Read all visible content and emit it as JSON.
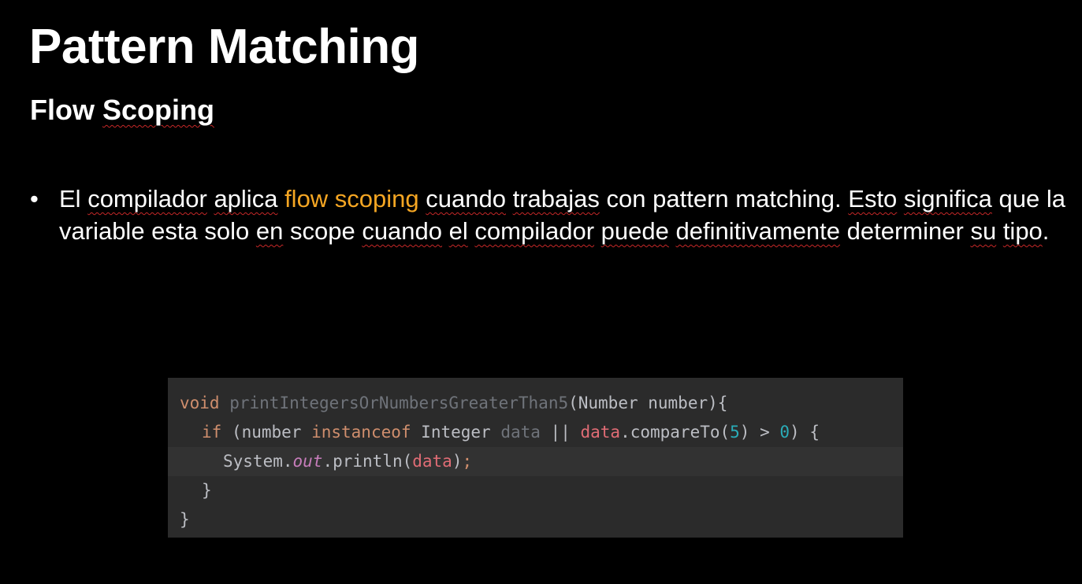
{
  "slide": {
    "title": "Pattern Matching",
    "subtitle": "Flow Scoping",
    "bullet": {
      "symbol": "•",
      "segments": [
        {
          "text": "El ",
          "style": "plain"
        },
        {
          "text": "compilador",
          "style": "squiggle"
        },
        {
          "text": " ",
          "style": "plain"
        },
        {
          "text": "aplica",
          "style": "squiggle"
        },
        {
          "text": " ",
          "style": "plain"
        },
        {
          "text": "flow scoping",
          "style": "highlight"
        },
        {
          "text": " ",
          "style": "plain"
        },
        {
          "text": "cuando",
          "style": "squiggle"
        },
        {
          "text": " ",
          "style": "plain"
        },
        {
          "text": "trabajas",
          "style": "squiggle"
        },
        {
          "text": " con pattern matching. ",
          "style": "plain"
        },
        {
          "text": "Esto",
          "style": "squiggle"
        },
        {
          "text": " ",
          "style": "plain"
        },
        {
          "text": "significa",
          "style": "squiggle"
        },
        {
          "text": " que la variable esta solo ",
          "style": "plain"
        },
        {
          "text": "en",
          "style": "squiggle"
        },
        {
          "text": " scope ",
          "style": "plain"
        },
        {
          "text": "cuando",
          "style": "squiggle"
        },
        {
          "text": " ",
          "style": "plain"
        },
        {
          "text": "el",
          "style": "squiggle"
        },
        {
          "text": " ",
          "style": "plain"
        },
        {
          "text": "compilador",
          "style": "squiggle"
        },
        {
          "text": " ",
          "style": "plain"
        },
        {
          "text": "puede",
          "style": "squiggle"
        },
        {
          "text": " ",
          "style": "plain"
        },
        {
          "text": "definitivamente",
          "style": "squiggle"
        },
        {
          "text": " determiner ",
          "style": "plain"
        },
        {
          "text": "su",
          "style": "squiggle"
        },
        {
          "text": " ",
          "style": "plain"
        },
        {
          "text": "tipo",
          "style": "squiggle"
        },
        {
          "text": ".",
          "style": "plain"
        }
      ]
    }
  },
  "code": {
    "lines": [
      {
        "indent": 0,
        "tokens": [
          {
            "text": "void",
            "style": "kw"
          },
          {
            "text": " ",
            "style": "ident"
          },
          {
            "text": "printIntegersOrNumbersGreaterThan5",
            "style": "method-dim"
          },
          {
            "text": "(Number number){",
            "style": "ident"
          }
        ]
      },
      {
        "indent": 1,
        "tokens": [
          {
            "text": "if",
            "style": "kw"
          },
          {
            "text": " (number ",
            "style": "ident"
          },
          {
            "text": "instanceof",
            "style": "kw"
          },
          {
            "text": " Integer ",
            "style": "ident"
          },
          {
            "text": "data",
            "style": "method-dim"
          },
          {
            "text": " || ",
            "style": "ident"
          },
          {
            "text": "data",
            "style": "var-red"
          },
          {
            "text": ".compareTo(",
            "style": "ident"
          },
          {
            "text": "5",
            "style": "num"
          },
          {
            "text": ") > ",
            "style": "ident"
          },
          {
            "text": "0",
            "style": "num"
          },
          {
            "text": ") {",
            "style": "ident"
          }
        ]
      },
      {
        "indent": 2,
        "current": true,
        "tokens": [
          {
            "text": "System.",
            "style": "ident"
          },
          {
            "text": "out",
            "style": "italic-field"
          },
          {
            "text": ".println(",
            "style": "ident"
          },
          {
            "text": "data",
            "style": "var-red"
          },
          {
            "text": ")",
            "style": "ident"
          },
          {
            "text": ";",
            "style": "semi"
          }
        ]
      },
      {
        "indent": 1,
        "tokens": [
          {
            "text": "}",
            "style": "ident"
          }
        ]
      },
      {
        "indent": 0,
        "tokens": [
          {
            "text": "}",
            "style": "ident"
          }
        ]
      }
    ]
  }
}
